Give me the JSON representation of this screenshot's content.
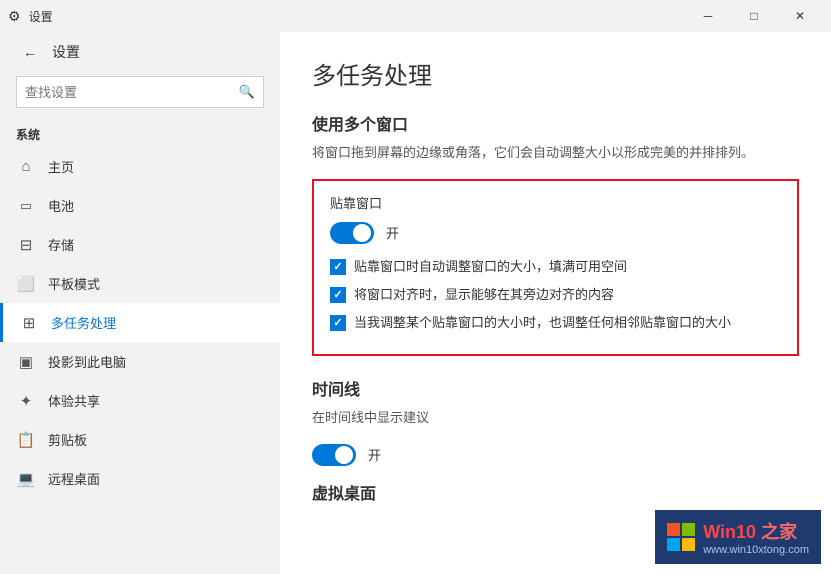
{
  "titlebar": {
    "title": "设置",
    "minimize": "─",
    "maximize": "□",
    "close": "✕"
  },
  "sidebar": {
    "back_label": "←",
    "title": "设置",
    "search_placeholder": "查找设置",
    "section_system": "系统",
    "items": [
      {
        "id": "home",
        "icon": "⌂",
        "label": "主页"
      },
      {
        "id": "battery",
        "icon": "□",
        "label": "电池"
      },
      {
        "id": "storage",
        "icon": "—",
        "label": "存储"
      },
      {
        "id": "tablet",
        "icon": "▭",
        "label": "平板模式"
      },
      {
        "id": "multitasking",
        "icon": "⊞",
        "label": "多任务处理",
        "active": true
      },
      {
        "id": "project",
        "icon": "⬜",
        "label": "投影到此电脑"
      },
      {
        "id": "share",
        "icon": "✿",
        "label": "体验共享"
      },
      {
        "id": "clipboard",
        "icon": "⊏",
        "label": "剪贴板"
      },
      {
        "id": "remote",
        "icon": "⊙",
        "label": "远程桌面"
      }
    ]
  },
  "main": {
    "page_title": "多任务处理",
    "section_windows": {
      "title": "使用多个窗口",
      "description": "将窗口拖到屏幕的边缘或角落，它们会自动调整大小以形成完美的并排排列。"
    },
    "snap_box": {
      "title": "贴靠窗口",
      "toggle_label": "开",
      "checkbox1": "贴靠窗口时自动调整窗口的大小，填满可用空间",
      "checkbox2": "将窗口对齐时，显示能够在其旁边对齐的内容",
      "checkbox3": "当我调整某个贴靠窗口的大小时，也调整任何相邻贴靠窗口的大小"
    },
    "timeline_section": {
      "title": "时间线",
      "sub_label": "在时间线中显示建议",
      "toggle_label": "开"
    },
    "virtual_desktop": {
      "title": "虚拟桌面"
    }
  },
  "watermark": {
    "brand": "Win10",
    "separator": " ",
    "suffix": "之家",
    "url": "www.win10xtong.com"
  }
}
